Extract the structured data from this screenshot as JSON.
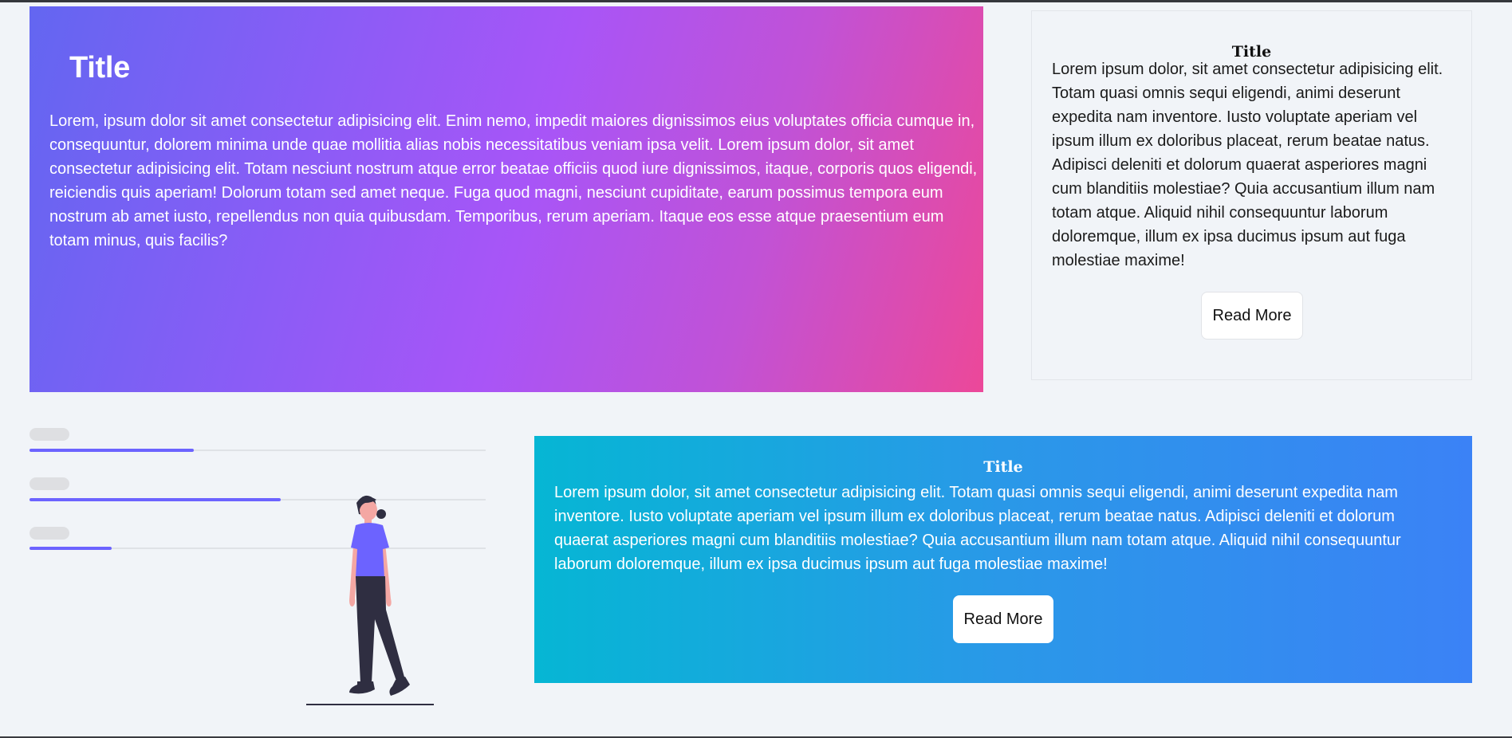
{
  "hero": {
    "title": "Title",
    "text": "Lorem, ipsum dolor sit amet consectetur adipisicing elit. Enim nemo, impedit maiores dignissimos eius voluptates officia cumque in, consequuntur, dolorem minima unde quae mollitia alias nobis necessitatibus veniam ipsa velit. Lorem ipsum dolor, sit amet consectetur adipisicing elit. Totam nesciunt nostrum atque error beatae officiis quod iure dignissimos, itaque, corporis quos eligendi, reiciendis quis aperiam! Dolorum totam sed amet neque. Fuga quod magni, nesciunt cupiditate, earum possimus tempora eum nostrum ab amet iusto, repellendus non quia quibusdam. Temporibus, rerum aperiam. Itaque eos esse atque praesentium eum totam minus, quis facilis?",
    "gradient_colors": [
      "#6366f1",
      "#a855f7",
      "#ec4899"
    ]
  },
  "side_card": {
    "title": "Title",
    "text": "Lorem ipsum dolor, sit amet consectetur adipisicing elit. Totam quasi omnis sequi eligendi, animi deserunt expedita nam inventore. Iusto voluptate aperiam vel ipsum illum ex doloribus placeat, rerum beatae natus. Adipisci deleniti et dolorum quaerat asperiores magni cum blanditiis molestiae? Quia accusantium illum nam totam atque. Aliquid nihil consequuntur laborum doloremque, illum ex ipsa ducimus ipsum aut fuga molestiae maxime!",
    "button_label": "Read More"
  },
  "illustration": {
    "progress_fractions": [
      0.36,
      0.55,
      0.18
    ],
    "accent_color": "#6c63ff"
  },
  "teal_card": {
    "title": "Title",
    "text": "Lorem ipsum dolor, sit amet consectetur adipisicing elit. Totam quasi omnis sequi eligendi, animi deserunt expedita nam inventore. Iusto voluptate aperiam vel ipsum illum ex doloribus placeat, rerum beatae natus. Adipisci deleniti et dolorum quaerat asperiores magni cum blanditiis molestiae? Quia accusantium illum nam totam atque. Aliquid nihil consequuntur laborum doloremque, illum ex ipsa ducimus ipsum aut fuga molestiae maxime!",
    "button_label": "Read More",
    "gradient_colors": [
      "#06b6d4",
      "#3b82f6"
    ]
  }
}
